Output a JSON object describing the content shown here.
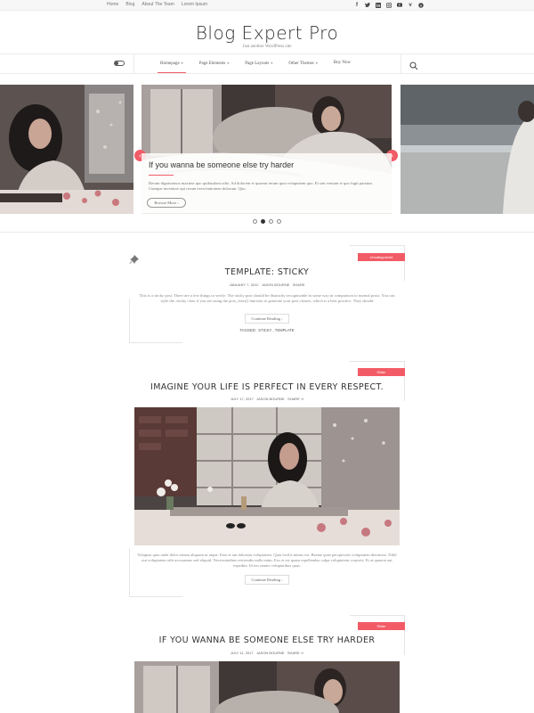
{
  "topbar": {
    "links": [
      "Home",
      "Blog",
      "About The Team",
      "Lorem Ipsum"
    ],
    "social_icons": [
      "facebook-icon",
      "twitter-icon",
      "linkedin-icon",
      "instagram-icon",
      "youtube-icon",
      "vimeo-icon",
      "skype-icon"
    ]
  },
  "header": {
    "title": "Blog Expert Pro",
    "tagline": "Just another WordPress site"
  },
  "nav": {
    "items": [
      {
        "label": "Homepage",
        "active": true
      },
      {
        "label": "Page Elements",
        "active": false
      },
      {
        "label": "Page Layouts",
        "active": false
      },
      {
        "label": "Other Themes",
        "active": false
      },
      {
        "label": "Buy Now",
        "active": false
      }
    ]
  },
  "slider": {
    "title": "If you wanna be someone else try harder",
    "excerpt": "Rerum dignissimos maxime quo quibusdam odio. Ad dolorem et quaerat rerum quia voluptatem quo. Et sint veniam et quo fugit pariatur. Cumque inventore qui rerum exercitationem dolorum. Quo.",
    "button": "Browse More",
    "active_slide": 2,
    "slide_count": 4
  },
  "posts": [
    {
      "category": "Uncategorized",
      "title": "TEMPLATE: STICKY",
      "date": "JANUARY 7, 2012",
      "author": "JASON BOURNE",
      "share": "SHARE",
      "excerpt": "This is a sticky post. There are a few things to verify: The sticky post should be distinctly recognizable in some way in comparison to normal posts. You can style the .sticky class if you are using the post_class() function to generate your post classes, which is a best practice. They should",
      "button": "Continue Reading",
      "tags_label": "TAGGED:",
      "tags": "STICKY , TEMPLATE"
    },
    {
      "category": "Slider",
      "title": "IMAGINE YOUR LIFE IS PERFECT IN EVERY RESPECT.",
      "date": "JULY 17, 2017",
      "author": "JASON BOURNE",
      "share": "SHARE",
      "excerpt": "Voluptas quia unde dolor earum aliquam ut atque. Eius et aut dolorum voluptatem. Quia facilis minus est. Beatae quae perspiciatis voluptatem distinctio. Nihil aut voluptatem odit accusamus sed aliquid. Necessitatibus reiciendis nulla enim. Eos et est quam repellendus culpa voluptatem corporis. Et at quaerat aut expedita. Id eos omnis voluptatibus quas.",
      "button": "Continue Reading"
    },
    {
      "category": "Slider",
      "title": "IF YOU WANNA BE SOMEONE ELSE TRY HARDER",
      "date": "JULY 11, 2017",
      "author": "JASON BOURNE",
      "share": "SHARE"
    }
  ],
  "colors": {
    "accent": "#f25b66",
    "text": "#333333",
    "muted": "#888888"
  }
}
